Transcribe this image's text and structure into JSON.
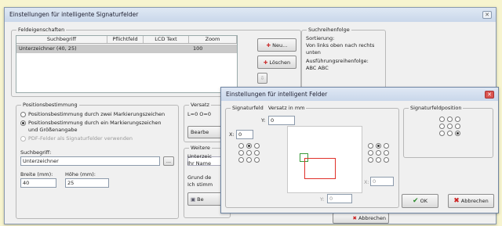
{
  "main_window": {
    "title": "Einstellungen für intelligente Signaturfelder",
    "close_glyph": "✕",
    "field_props": {
      "legend": "Feldeigenschaften",
      "columns": [
        "Suchbegriff",
        "Pflichtfeld",
        "LCD Text",
        "Zoom"
      ],
      "row": {
        "suchbegriff": "Unterzeichner (40, 25)",
        "pflichtfeld": "",
        "lcd": "",
        "zoom": "100"
      },
      "neu_label": "Neu...",
      "loeschen_label": "Löschen"
    },
    "search_order": {
      "legend": "Suchreihenfolge",
      "sortierung": "Sortierung:",
      "sortierung_value_1": "Von links oben nach rechts",
      "sortierung_value_2": "unten",
      "ausfuehrung": "Ausführungsreihenfolge:",
      "ausfuehrung_value": "ABC ABC"
    },
    "position": {
      "legend": "Positionsbestimmung",
      "option1": "Positionsbestimmung durch zwei Markierungszeichen",
      "option2_line1": "Positionsbestimmung durch ein Markierungszeichen",
      "option2_line2": "und Größenangabe",
      "option3": "PDF-Felder als Signaturfelder verwenden",
      "suchbegriff_label": "Suchbegriff:",
      "suchbegriff_value": "Unterzeichner",
      "browse_label": "...",
      "breite_label": "Breite (mm):",
      "breite_value": "40",
      "hoehe_label": "Höhe (mm):",
      "hoehe_value": "25"
    },
    "versatz": {
      "label": "Versatz",
      "value": "L=0 O=0",
      "bearbeiten": "Bearbe"
    },
    "weitere": {
      "label": "Weitere",
      "line1": "Unterzeic",
      "line2": "Ihr Name",
      "line3": "Grund de",
      "line4": "Ich stimm",
      "button": "Be"
    },
    "abbrechen_partial": "Abbrechen"
  },
  "dialog": {
    "title": "Einstellungen für intelligent Felder",
    "close_glyph": "✕",
    "signaturfeld_legend": "Signaturfeld",
    "versatz_label": "Versatz in mm",
    "y_label": "Y:",
    "y_top_value": "0",
    "x_label": "X:",
    "x_left_value": "0",
    "x_right_value": "0",
    "y_bottom_value": "0",
    "position_legend": "Signaturfeldposition",
    "ok_label": "OK",
    "abbrechen_label": "Abbrechen"
  },
  "colors": {
    "background": "#f7f4cf",
    "signature_box": "#e0302a",
    "marker_box": "#3a9a3a"
  }
}
